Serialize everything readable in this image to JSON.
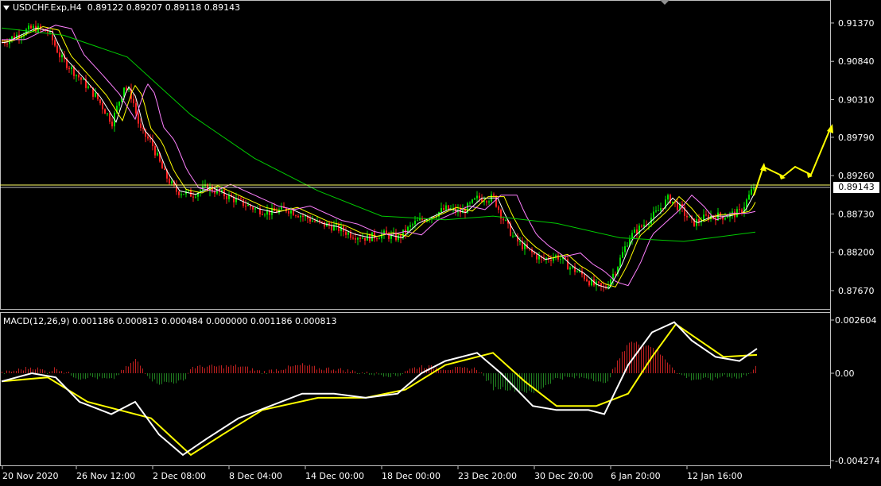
{
  "header": {
    "symbol_timeframe": "USDCHF.Exp,H4",
    "ohlc": "0.89122 0.89207 0.89118 0.89143"
  },
  "macd_header": {
    "label": "MACD(12,26,9) 0.001186 0.000813 0.000484 0.000000 0.001186 0.000813"
  },
  "current_price_label": "0.89143",
  "price_axis": [
    "0.91370",
    "0.90840",
    "0.90310",
    "0.89790",
    "0.89260",
    "0.88730",
    "0.88200",
    "0.87670"
  ],
  "macd_axis": [
    "0.002604",
    "0.00",
    "-0.004274"
  ],
  "time_axis": [
    "20 Nov 2020",
    "26 Nov 12:00",
    "2 Dec 08:00",
    "8 Dec 04:00",
    "14 Dec 00:00",
    "18 Dec 00:00",
    "23 Dec 20:00",
    "30 Dec 20:00",
    "6 Jan 20:00",
    "12 Jan 16:00"
  ],
  "colors": {
    "background": "#000000",
    "bull_candle": "#00e000",
    "bear_candle": "#ff2020",
    "ma_fast": "#ffffff",
    "ma_mid": "#ffff00",
    "ma_slow": "#ff80ff",
    "ma_long": "#00cc00",
    "macd_line": "#ffffff",
    "signal_line": "#ffff00",
    "hist_pos": "#c02020",
    "hist_neg": "#208020",
    "forecast_arrow": "#ffff00",
    "price_line": "#ffffff",
    "level_line": "#ffff66"
  },
  "chart_data": {
    "type": "line",
    "title": "USDCHF.Exp,H4",
    "price_ylim": [
      0.8745,
      0.916
    ],
    "close_series_approx": [
      {
        "x": "20 Nov 2020",
        "y": 0.911
      },
      {
        "x": "26 Nov 12:00",
        "y": 0.904
      },
      {
        "x": "2 Dec 08:00",
        "y": 0.891
      },
      {
        "x": "8 Dec 04:00",
        "y": 0.888
      },
      {
        "x": "14 Dec 00:00",
        "y": 0.8835
      },
      {
        "x": "18 Dec 00:00",
        "y": 0.8845
      },
      {
        "x": "23 Dec 20:00",
        "y": 0.889
      },
      {
        "x": "30 Dec 20:00",
        "y": 0.88
      },
      {
        "x": "6 Jan 20:00",
        "y": 0.885
      },
      {
        "x": "12 Jan 16:00",
        "y": 0.888
      }
    ],
    "last_close": 0.89143,
    "macd_ylim": [
      -0.004274,
      0.002604
    ]
  }
}
